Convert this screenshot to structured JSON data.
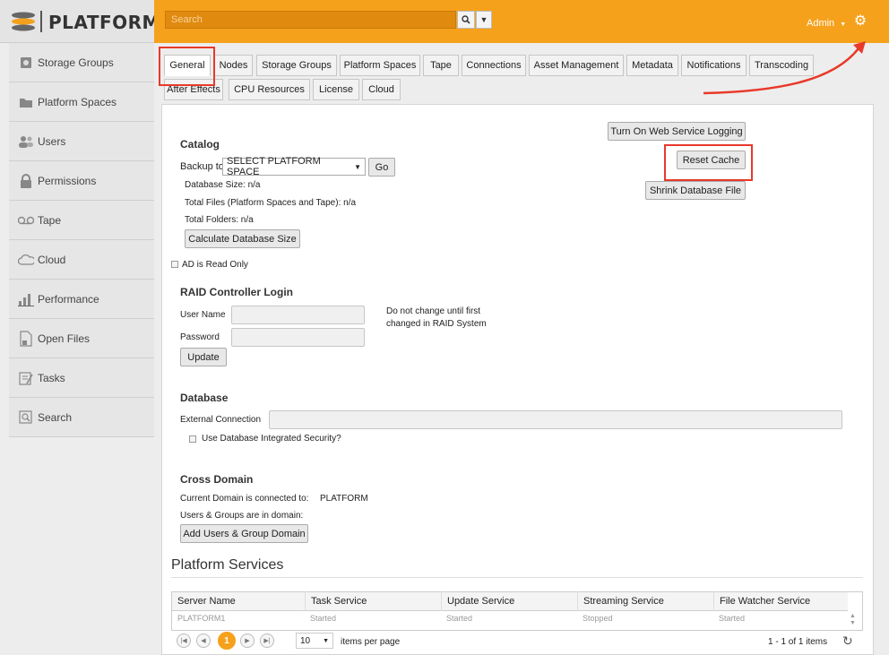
{
  "header": {
    "logo_text": "PLATFORM",
    "search_placeholder": "Search",
    "admin_label": "Admin",
    "colors": {
      "accent": "#f5a11c",
      "highlight": "#e8392a"
    }
  },
  "sidebar": {
    "items": [
      {
        "label": "Storage Groups",
        "icon": "storage-groups-icon"
      },
      {
        "label": "Platform Spaces",
        "icon": "folder-icon"
      },
      {
        "label": "Users",
        "icon": "users-icon"
      },
      {
        "label": "Permissions",
        "icon": "lock-icon"
      },
      {
        "label": "Tape",
        "icon": "tape-icon"
      },
      {
        "label": "Cloud",
        "icon": "cloud-icon"
      },
      {
        "label": "Performance",
        "icon": "performance-icon"
      },
      {
        "label": "Open Files",
        "icon": "open-files-icon"
      },
      {
        "label": "Tasks",
        "icon": "tasks-icon"
      },
      {
        "label": "Search",
        "icon": "search-icon"
      }
    ]
  },
  "tabs": {
    "row1": [
      "General",
      "Nodes",
      "Storage Groups",
      "Platform Spaces",
      "Tape",
      "Connections",
      "Asset Management",
      "Metadata",
      "Notifications",
      "Transcoding"
    ],
    "row2": [
      "After Effects",
      "CPU Resources",
      "License",
      "Cloud"
    ]
  },
  "catalog": {
    "title": "Catalog",
    "backup_label": "Backup to",
    "backup_select": "SELECT PLATFORM SPACE",
    "go_label": "Go",
    "db_size": "Database Size: n/a",
    "total_files": "Total Files (Platform Spaces and Tape): n/a",
    "total_folders": "Total Folders: n/a",
    "calc_label": "Calculate Database Size",
    "ad_readonly": "AD is Read Only"
  },
  "right_actions": {
    "logging_label": "Turn On Web Service Logging",
    "reset_cache_label": "Reset Cache",
    "shrink_label": "Shrink Database File"
  },
  "raid": {
    "title": "RAID Controller Login",
    "user_label": "User Name",
    "password_label": "Password",
    "note_line1": "Do not change until first",
    "note_line2": "changed in RAID System",
    "update_label": "Update"
  },
  "database": {
    "title": "Database",
    "external_label": "External Connection",
    "integrated_label": "Use Database Integrated Security?"
  },
  "cross_domain": {
    "title": "Cross Domain",
    "connected_label": "Current Domain is connected to:",
    "connected_value": "PLATFORM",
    "users_groups_label": "Users & Groups are in domain:",
    "add_label": "Add Users & Group Domain"
  },
  "services": {
    "title": "Platform Services",
    "columns": [
      "Server Name",
      "Task Service",
      "Update Service",
      "Streaming Service",
      "File Watcher Service"
    ],
    "rows": [
      [
        "PLATFORM1",
        "Started",
        "Started",
        "Stopped",
        "Started"
      ]
    ],
    "page_current": "1",
    "page_size": "10",
    "items_per_page_label": "items per page",
    "range_label": "1 - 1 of 1 items"
  }
}
